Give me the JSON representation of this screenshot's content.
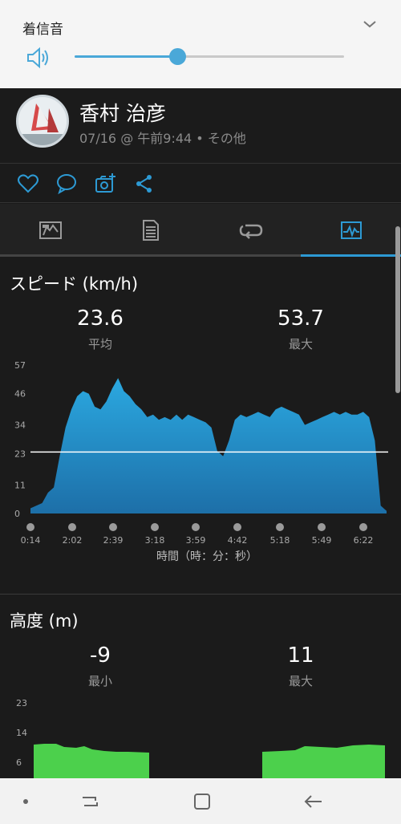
{
  "volume": {
    "title": "着信音",
    "level_percent": 38,
    "accent_color": "#4aa8d8"
  },
  "header": {
    "user_name": "香村 治彦",
    "meta": "07/16 @ 午前9:44 • その他",
    "avatar_icon": "windsurf-avatar"
  },
  "actions": [
    {
      "icon": "heart-icon"
    },
    {
      "icon": "comment-icon"
    },
    {
      "icon": "add-photo-icon"
    },
    {
      "icon": "share-icon"
    }
  ],
  "tabs": [
    {
      "icon": "summary-icon",
      "active": false
    },
    {
      "icon": "details-icon",
      "active": false
    },
    {
      "icon": "laps-icon",
      "active": false
    },
    {
      "icon": "chart-icon",
      "active": true
    }
  ],
  "speed": {
    "title": "スピード (km/h)",
    "avg_value": "23.6",
    "avg_label": "平均",
    "max_value": "53.7",
    "max_label": "最大"
  },
  "altitude": {
    "title": "高度 (m)",
    "min_value": "-9",
    "min_label": "最小",
    "max_value": "11",
    "max_label": "最大"
  },
  "chart_data": [
    {
      "type": "area",
      "xlabel": "時間（時：分：秒）",
      "ylabel": "スピード (km/h)",
      "yticks": [
        "57",
        "46",
        "34",
        "23",
        "11",
        "0"
      ],
      "ytick_values": [
        57,
        46,
        34,
        23,
        11,
        0
      ],
      "ylim": [
        0,
        57
      ],
      "xticks": [
        "0:14",
        "2:02",
        "2:39",
        "3:18",
        "3:59",
        "4:42",
        "5:18",
        "5:49",
        "6:22"
      ],
      "average_line": 23.6,
      "fill_color": "#2b9fd8",
      "values": [
        2,
        3,
        4,
        8,
        10,
        22,
        33,
        40,
        45,
        47,
        46,
        41,
        40,
        43,
        48,
        52,
        47,
        45,
        42,
        40,
        37,
        38,
        36,
        37,
        36,
        38,
        36,
        38,
        37,
        36,
        35,
        33,
        24,
        22,
        28,
        36,
        38,
        37,
        38,
        39,
        38,
        37,
        40,
        41,
        40,
        39,
        38,
        34,
        35,
        36,
        37,
        38,
        39,
        38,
        39,
        38,
        38,
        39,
        37,
        28,
        3,
        1
      ],
      "grid": false
    },
    {
      "type": "area",
      "ylabel": "高度 (m)",
      "yticks": [
        "23",
        "14",
        "6"
      ],
      "ytick_values": [
        23,
        14,
        6
      ],
      "fill_color": "#4cd04c",
      "visible_portion": true,
      "grid": false
    }
  ]
}
